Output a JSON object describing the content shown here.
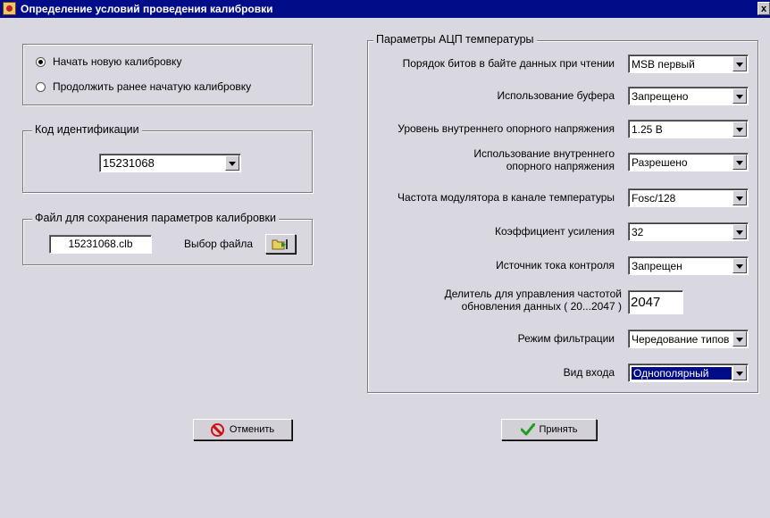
{
  "window": {
    "title": "Определение условий проведения калибровки",
    "close": "x"
  },
  "mode": {
    "options": [
      {
        "label": "Начать новую калибровку",
        "checked": true
      },
      {
        "label": "Продолжить ранее начатую калибровку",
        "checked": false
      }
    ]
  },
  "ident": {
    "legend": "Код идентификации",
    "value": "15231068"
  },
  "file": {
    "legend": "Файл для сохранения параметров калибровки",
    "filename": "15231068.clb",
    "choose_label": "Выбор файла"
  },
  "adc": {
    "legend": "Параметры АЦП температуры",
    "params": [
      {
        "label": "Порядок битов в байте данных при чтении",
        "value": "MSB первый"
      },
      {
        "label": "Использование буфера",
        "value": "Запрещено"
      },
      {
        "label": "Уровень внутреннего опорного напряжения",
        "value": "1.25 В"
      },
      {
        "label": "Использование внутреннего опорного напряжения",
        "line1": "Использование внутреннего",
        "line2": "опорного напряжения",
        "value": "Разрешено"
      },
      {
        "label": "Частота модулятора в канале температуры",
        "value": "Fosc/128"
      },
      {
        "label": "Коэффициент усиления",
        "value": "32"
      },
      {
        "label": "Источник тока контроля",
        "value": "Запрещен"
      },
      {
        "label": "Делитель для управления частотой обновления данных ( 20...2047 )",
        "line1": "Делитель для управления частотой",
        "line2": "обновления данных ( 20...2047 )",
        "value": "2047"
      },
      {
        "label": "Режим фильтрации",
        "value": "Чередование типов"
      },
      {
        "label": "Вид входа",
        "value": "Однополярный"
      }
    ]
  },
  "buttons": {
    "cancel": "Отменить",
    "accept": "Принять"
  },
  "colors": {
    "title_bar": "#000c88",
    "background": "#d9d8e0",
    "cancel_icon": "#d01010",
    "accept_icon": "#1e9e20"
  }
}
